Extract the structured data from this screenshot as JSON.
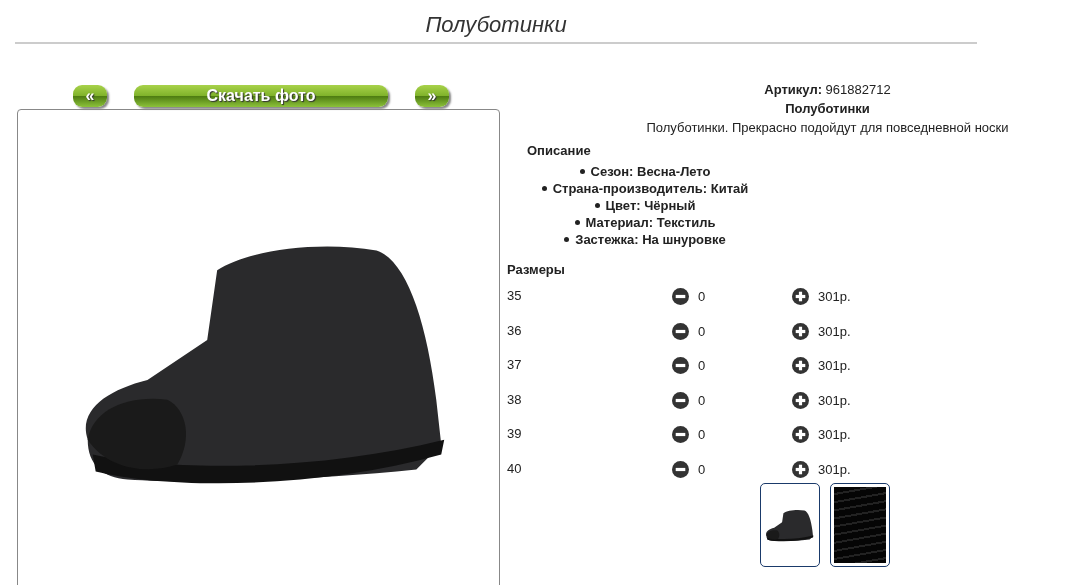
{
  "title": "Полуботинки",
  "gallery": {
    "prev": "«",
    "download": "Скачать фото",
    "next": "»"
  },
  "article": {
    "label": "Артикул:",
    "value": "961882712"
  },
  "name": "Полуботинки",
  "summary": "Полуботинки. Прекрасно подойдут для повседневной носки",
  "description": {
    "heading": "Описание",
    "items": [
      "Сезон: Весна-Лето",
      "Страна-производитель: Китай",
      "Цвет: Чёрный",
      "Материал: Текстиль",
      "Застежка: На шнуровке"
    ]
  },
  "sizes": {
    "heading": "Размеры",
    "rows": [
      {
        "size": "35",
        "count": "0",
        "price": "301р."
      },
      {
        "size": "36",
        "count": "0",
        "price": "301р."
      },
      {
        "size": "37",
        "count": "0",
        "price": "301р."
      },
      {
        "size": "38",
        "count": "0",
        "price": "301р."
      },
      {
        "size": "39",
        "count": "0",
        "price": "301р."
      },
      {
        "size": "40",
        "count": "0",
        "price": "301р."
      }
    ]
  },
  "thumbnails": [
    {
      "kind": "shoe"
    },
    {
      "kind": "laces"
    }
  ]
}
